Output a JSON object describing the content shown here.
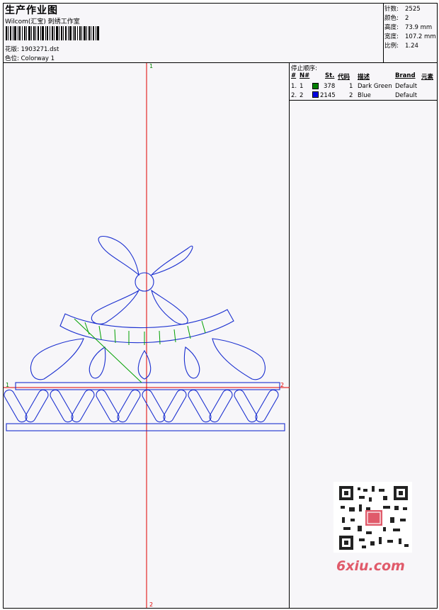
{
  "header": {
    "title": "生产作业图",
    "company": "Wilcom(汇宝) 刺绣工作室",
    "design_label": "花版:",
    "design_file": "1903271.dst",
    "colorway_label": "色位:",
    "colorway": "Colorway 1"
  },
  "stats": [
    {
      "label": "针数:",
      "value": "2525"
    },
    {
      "label": "颜色:",
      "value": "2"
    },
    {
      "label": "高度:",
      "value": "73.9 mm"
    },
    {
      "label": "宽度:",
      "value": "107.2 mm"
    },
    {
      "label": "比例:",
      "value": "1.24"
    }
  ],
  "stop_table": {
    "title": "停止顺序:",
    "headers": [
      "#",
      "N#",
      "St.",
      "代码",
      "描述",
      "Brand",
      "元素"
    ],
    "rows": [
      {
        "num": "1.",
        "n": "1",
        "color": "#008000",
        "stitches": "378",
        "code": "1",
        "description": "Dark Green",
        "brand": "Default"
      },
      {
        "num": "2.",
        "n": "2",
        "color": "#0000e0",
        "stitches": "2145",
        "code": "2",
        "description": "Blue",
        "brand": "Default"
      }
    ]
  },
  "markers": {
    "top": "1",
    "bottom": "2",
    "left": "1",
    "right": "2"
  },
  "colors": {
    "guide": "#e00000",
    "stitch_blue": "#1a2fd0",
    "stitch_green": "#00a000",
    "watermark": "#e05a6a"
  },
  "watermark": {
    "text": "6xiu.com"
  }
}
